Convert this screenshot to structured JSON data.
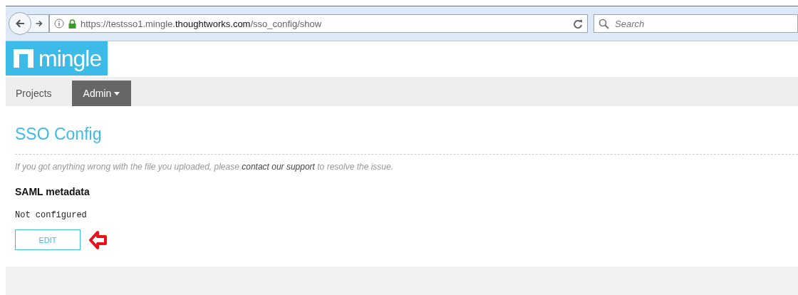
{
  "browser": {
    "url": "https://testsso1.mingle.**thoughtworks.com**/sso_config/show",
    "search": {
      "placeholder": "Search"
    }
  },
  "logo": {
    "text": "mingle"
  },
  "nav": [
    {
      "label": "Projects",
      "selected": false,
      "dropdown": false
    },
    {
      "label": "Admin",
      "selected": true,
      "dropdown": true
    }
  ],
  "page": {
    "title": "SSO Config",
    "notice": {
      "before": "If you got anything wrong with the file you uploaded, please ",
      "link": "contact our support",
      "after": " to resolve the issue."
    },
    "section_title": "SAML metadata",
    "status": "Not configured",
    "button": "EDIT"
  }
}
